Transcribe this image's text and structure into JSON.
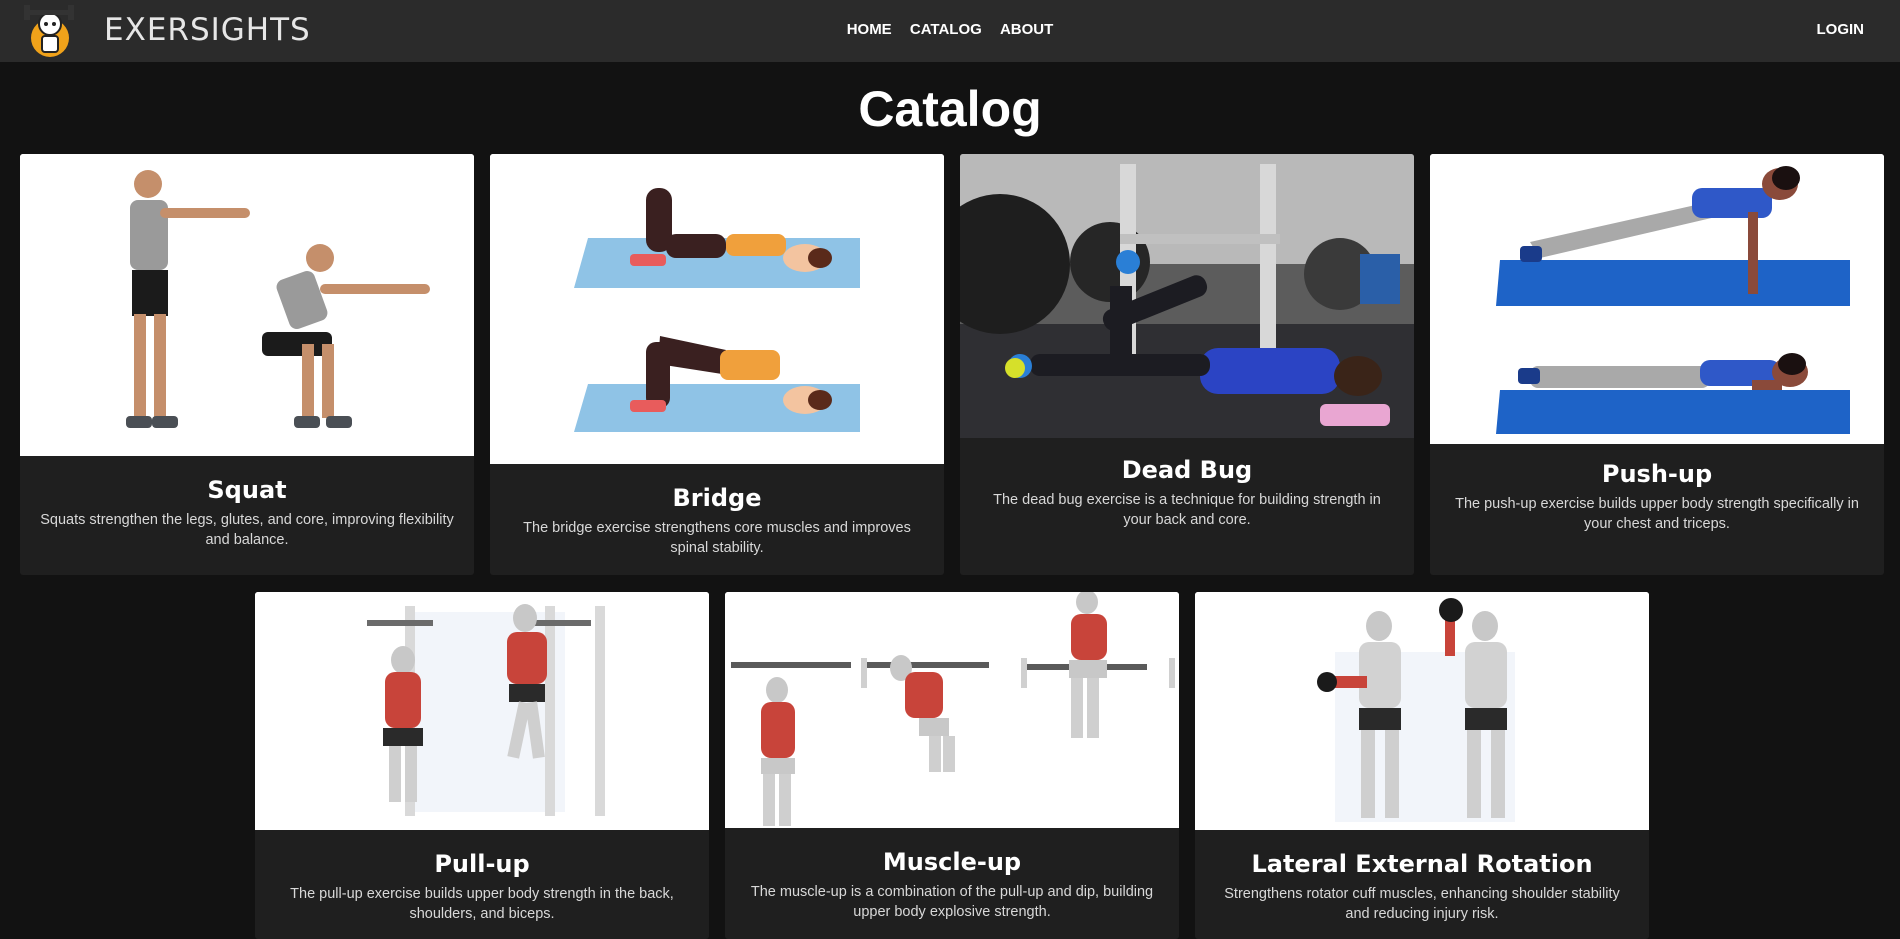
{
  "navbar": {
    "brand": "EXERSIGHTS",
    "links": [
      "HOME",
      "CATALOG",
      "ABOUT"
    ],
    "login": "LOGIN"
  },
  "page": {
    "title": "Catalog"
  },
  "exercises": [
    {
      "name": "Squat",
      "description": "Squats strengthen the legs, glutes, and core, improving flexibility and balance."
    },
    {
      "name": "Bridge",
      "description": "The bridge exercise strengthens core muscles and improves spinal stability."
    },
    {
      "name": "Dead Bug",
      "description": "The dead bug exercise is a technique for building strength in your back and core."
    },
    {
      "name": "Push-up",
      "description": "The push-up exercise builds upper body strength specifically in your chest and triceps."
    },
    {
      "name": "Pull-up",
      "description": "The pull-up exercise builds upper body strength in the back, shoulders, and biceps."
    },
    {
      "name": "Muscle-up",
      "description": "The muscle-up is a combination of the pull-up and dip, building upper body explosive strength."
    },
    {
      "name": "Lateral External Rotation",
      "description": "Strengthens rotator cuff muscles, enhancing shoulder stability and reducing injury risk."
    }
  ],
  "colors": {
    "background": "#121212",
    "navbar": "#2b2b2b",
    "card": "#1f1f1f",
    "logo_accent": "#f0a21a"
  }
}
